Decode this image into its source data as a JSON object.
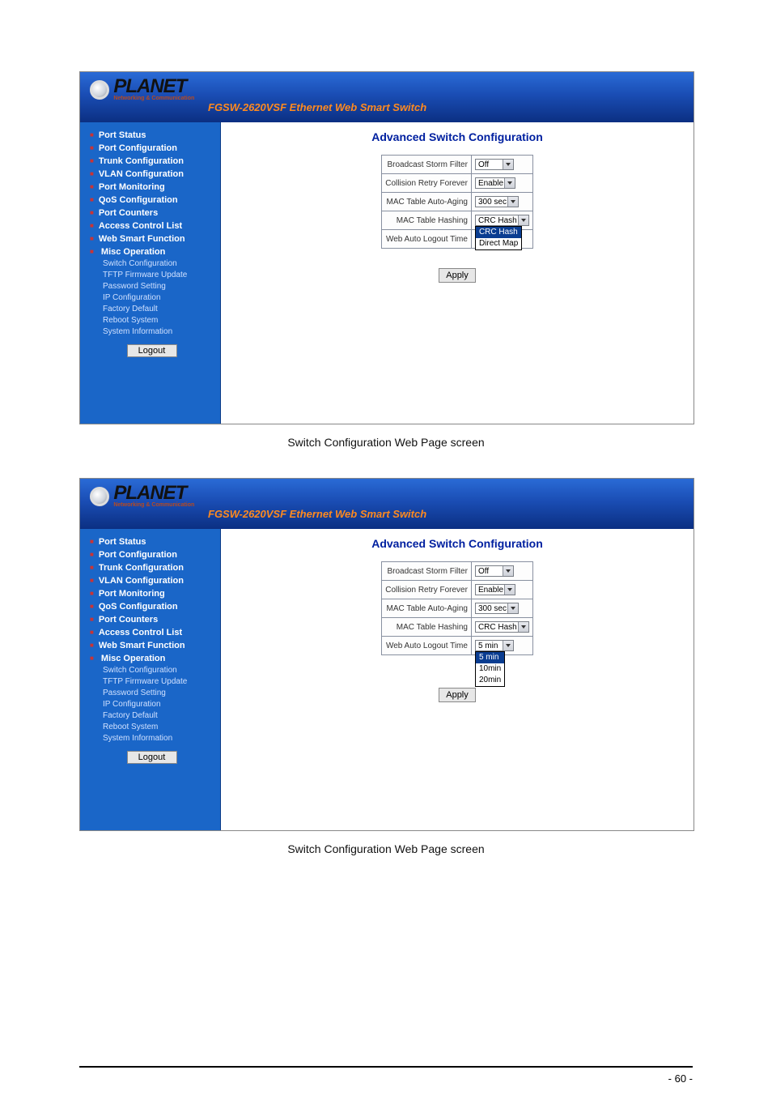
{
  "header": {
    "brand": "PLANET",
    "brand_sub": "Networking & Communication",
    "title": "FGSW-2620VSF Ethernet Web Smart Switch"
  },
  "sidebar": {
    "items": [
      "Port Status",
      "Port Configuration",
      "Trunk Configuration",
      "VLAN Configuration",
      "Port Monitoring",
      "QoS Configuration",
      "Port Counters",
      "Access Control List",
      "Web Smart Function",
      "Misc Operation"
    ],
    "sub": [
      "Switch Configuration",
      "TFTP Firmware Update",
      "Password Setting",
      "IP Configuration",
      "Factory Default",
      "Reboot System",
      "System Information"
    ],
    "logout": "Logout"
  },
  "panel": {
    "title": "Advanced Switch Configuration",
    "rows": [
      {
        "label": "Broadcast Storm Filter",
        "key": "bsf"
      },
      {
        "label": "Collision Retry Forever",
        "key": "crf"
      },
      {
        "label": "MAC Table Auto-Aging",
        "key": "age"
      },
      {
        "label": "MAC Table Hashing",
        "key": "hash"
      },
      {
        "label": "Web Auto Logout Time",
        "key": "logout"
      }
    ],
    "apply": "Apply"
  },
  "shot1": {
    "values": {
      "bsf": "Off",
      "crf": "Enable",
      "age": "300 sec",
      "hash": "CRC Hash",
      "logout": ""
    },
    "dropdown": {
      "on": "hash",
      "options": [
        "CRC Hash",
        "Direct Map"
      ],
      "selected": "CRC Hash"
    }
  },
  "shot2": {
    "values": {
      "bsf": "Off",
      "crf": "Enable",
      "age": "300 sec",
      "hash": "CRC Hash",
      "logout": "5 min"
    },
    "dropdown": {
      "on": "logout",
      "options": [
        "5 min",
        "10min",
        "20min"
      ],
      "selected": "5 min"
    }
  },
  "caption": "Switch Configuration Web Page screen",
  "page_number": "- 60 -"
}
